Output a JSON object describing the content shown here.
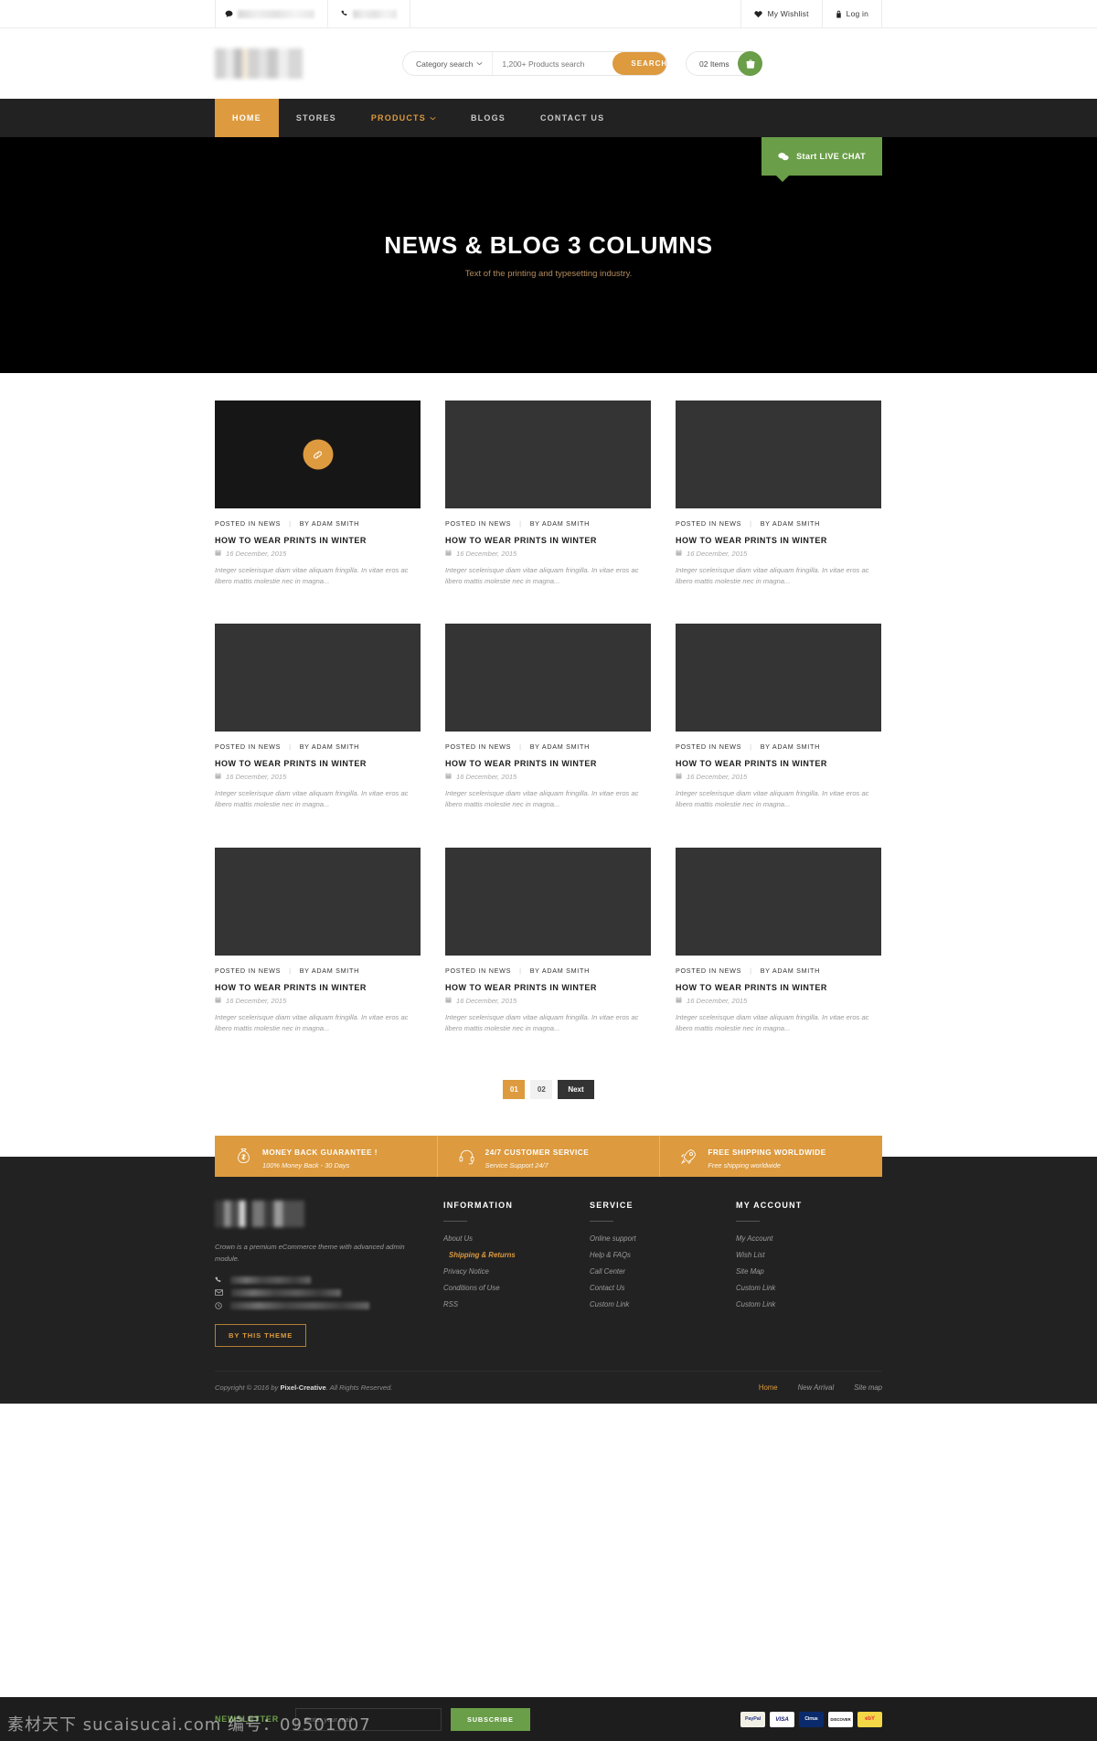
{
  "topbar": {
    "chat_icon": "chat-bubble-icon",
    "phone_icon": "phone-icon",
    "wishlist_label": "My Wishlist",
    "wishlist_icon": "heart-icon",
    "login_label": "Log in",
    "login_icon": "lock-icon"
  },
  "header": {
    "logo": "site-logo",
    "category_label": "Category search",
    "search_placeholder": "1,200+ Products search",
    "search_value": "",
    "search_button": "SEARCH",
    "cart_items": "02 Items",
    "cart_icon": "shopping-basket-icon"
  },
  "nav": {
    "items": [
      {
        "label": "HOME",
        "state": "active"
      },
      {
        "label": "STORES",
        "state": "normal"
      },
      {
        "label": "PRODUCTS",
        "state": "hot"
      },
      {
        "label": "BLOGS",
        "state": "normal"
      },
      {
        "label": "CONTACT US",
        "state": "normal"
      }
    ],
    "livechat_label": "Start LIVE CHAT",
    "livechat_icon": "chat-bubbles-icon"
  },
  "hero": {
    "title": "NEWS & BLOG 3 COLUMNS",
    "subtitle": "Text of the printing and typesetting industry."
  },
  "blog": {
    "posted_in": "POSTED IN NEWS",
    "author": "BY ADAM SMITH",
    "title": "HOW TO WEAR PRINTS IN WINTER",
    "date": "16 December, 2015",
    "excerpt": "Integer scelerisque diam vitae aliquam fringilla. In vitae eros ac libero mattis molestie nec in magna...",
    "date_icon": "calendar-icon",
    "link_icon": "link-icon",
    "posts": [
      {
        "featured": true
      },
      {
        "featured": false
      },
      {
        "featured": false
      },
      {
        "featured": false
      },
      {
        "featured": false
      },
      {
        "featured": false
      },
      {
        "featured": false
      },
      {
        "featured": false
      },
      {
        "featured": false
      }
    ]
  },
  "pagination": {
    "pages": [
      {
        "label": "01",
        "state": "active"
      },
      {
        "label": "02",
        "state": "normal"
      },
      {
        "label": "Next",
        "state": "next"
      }
    ]
  },
  "services": [
    {
      "icon": "money-bag-icon",
      "title": "MONEY BACK GUARANTEE !",
      "sub": "100% Money Back - 30 Days"
    },
    {
      "icon": "headset-icon",
      "title": "24/7 CUSTOMER SERVICE",
      "sub": "Service Support 24/7"
    },
    {
      "icon": "rocket-icon",
      "title": "FREE SHIPPING WORLDWIDE",
      "sub": "Free shipping worldwide"
    }
  ],
  "footer": {
    "about_text": "Crown is a premium eCommerce theme with advanced admin module.",
    "phone_icon": "phone-icon",
    "mail_icon": "envelope-icon",
    "clock_icon": "clock-icon",
    "theme_button": "BY THIS THEME",
    "columns": [
      {
        "title": "INFORMATION",
        "links": [
          {
            "label": "About Us",
            "highlight": false
          },
          {
            "label": "Shipping & Returns",
            "highlight": true
          },
          {
            "label": "Privacy Notice",
            "highlight": false
          },
          {
            "label": "Conditions of Use",
            "highlight": false
          },
          {
            "label": "RSS",
            "highlight": false
          }
        ]
      },
      {
        "title": "SERVICE",
        "links": [
          {
            "label": "Online support",
            "highlight": false
          },
          {
            "label": "Help & FAQs",
            "highlight": false
          },
          {
            "label": "Call Center",
            "highlight": false
          },
          {
            "label": "Contact Us",
            "highlight": false
          },
          {
            "label": "Custom Link",
            "highlight": false
          }
        ]
      },
      {
        "title": "MY ACCOUNT",
        "links": [
          {
            "label": "My Account",
            "highlight": false
          },
          {
            "label": "Wish List",
            "highlight": false
          },
          {
            "label": "Site Map",
            "highlight": false
          },
          {
            "label": "Custom Link",
            "highlight": false
          },
          {
            "label": "Custom Link",
            "highlight": false
          }
        ]
      }
    ]
  },
  "copyright": {
    "prefix": "Copyright © 2016 by ",
    "brand": "Pixel-Creative",
    "suffix": ". All Rights Reserved.",
    "links": [
      {
        "label": "Home",
        "active": true
      },
      {
        "label": "New Arrival",
        "active": false
      },
      {
        "label": "Site map",
        "active": false
      }
    ]
  },
  "newsletter": {
    "label": "NEWSLETTER",
    "placeholder": "Enter your mail",
    "value": "",
    "button": "SUBSCRIBE",
    "payments": [
      "PayPal",
      "VISA",
      "Cirrus",
      "DISCOVER",
      "ebY"
    ]
  },
  "watermark": "素材天下 sucaisucai.com  编号：09501007",
  "colors": {
    "accent": "#dd9a3e",
    "green": "#6a9e48",
    "dark": "#222222",
    "hero_bg": "#000000",
    "thumb": "#343434"
  }
}
